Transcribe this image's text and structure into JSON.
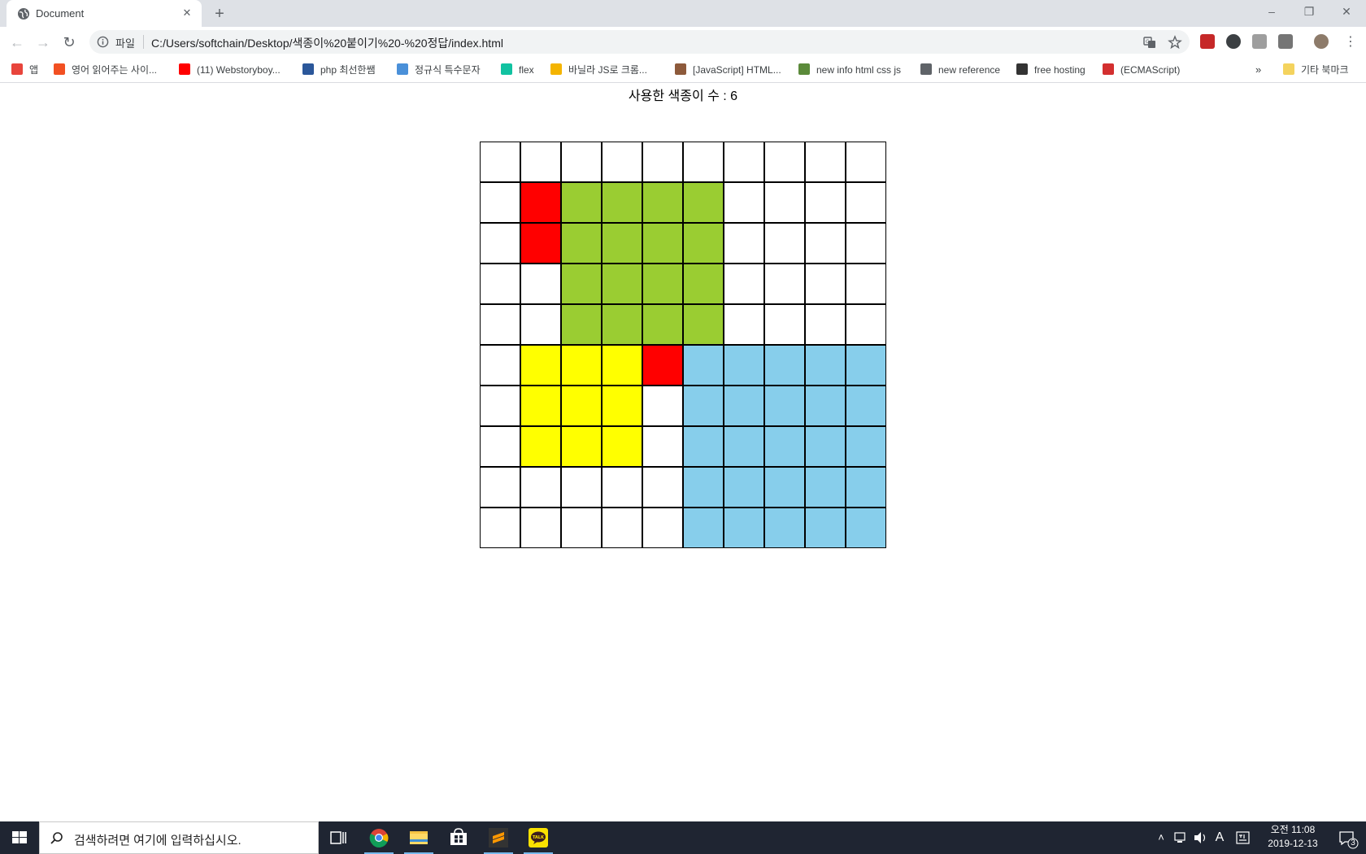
{
  "browser": {
    "tab": {
      "title": "Document"
    },
    "address": {
      "scheme_label": "파일",
      "url": "C:/Users/softchain/Desktop/색종이%20붙이기%20-%20정답/index.html"
    },
    "bookmarks": [
      {
        "label": "앱",
        "icon": "apps-grid-icon",
        "color": "#e8453c"
      },
      {
        "label": "영어 읽어주는 사이...",
        "icon": "ms-logo-icon",
        "color": "#f25022"
      },
      {
        "label": "(11) Webstoryboy...",
        "icon": "youtube-icon",
        "color": "#ff0000"
      },
      {
        "label": "php 최선한쌤",
        "icon": "word-icon",
        "color": "#2b579a"
      },
      {
        "label": "정규식 특수문자",
        "icon": "t-icon",
        "color": "#4a90d9"
      },
      {
        "label": "flex",
        "icon": "d2-icon",
        "color": "#11c2a1"
      },
      {
        "label": "바닐라 JS로 크롬...",
        "icon": "warning-icon",
        "color": "#f4b400"
      },
      {
        "label": "[JavaScript] HTML...",
        "icon": "avatar-icon",
        "color": "#8d5a3b"
      },
      {
        "label": "new info html css js",
        "icon": "tree-icon",
        "color": "#5b8a3a"
      },
      {
        "label": "new reference",
        "icon": "globe-icon",
        "color": "#5f6368"
      },
      {
        "label": "free hosting",
        "icon": "dothome-icon",
        "color": "#333333"
      },
      {
        "label": "(ECMAScript)",
        "icon": "z-icon",
        "color": "#d32f2f"
      }
    ],
    "other_bookmarks": "기타 북마크"
  },
  "page": {
    "title": "사용한 색종이 수 : 6",
    "grid": {
      "rows": 10,
      "cols": 10,
      "colors": {
        "w": "#ffffff",
        "r": "#ff0000",
        "g": "#9acd32",
        "y": "#ffff00",
        "b": "#87ceeb"
      },
      "cells": [
        "wwwwwwwwww",
        "wrggggwwww",
        "wrggggwwww",
        "wwggggwwww",
        "wwggggwwww",
        "wyyyrbbbbb",
        "wyyywbbbbb",
        "wyyywbbbbb",
        "wwwwwbbbbb",
        "wwwwwbbbbb"
      ]
    }
  },
  "taskbar": {
    "search_placeholder": "검색하려면 여기에 입력하십시오.",
    "apps": [
      "task-view-icon",
      "chrome-icon",
      "file-explorer-icon",
      "store-icon",
      "sublime-text-icon",
      "kakaotalk-icon"
    ],
    "ime_label": "A",
    "time": "오전 11:08",
    "date": "2019-12-13",
    "notification_count": "3"
  }
}
